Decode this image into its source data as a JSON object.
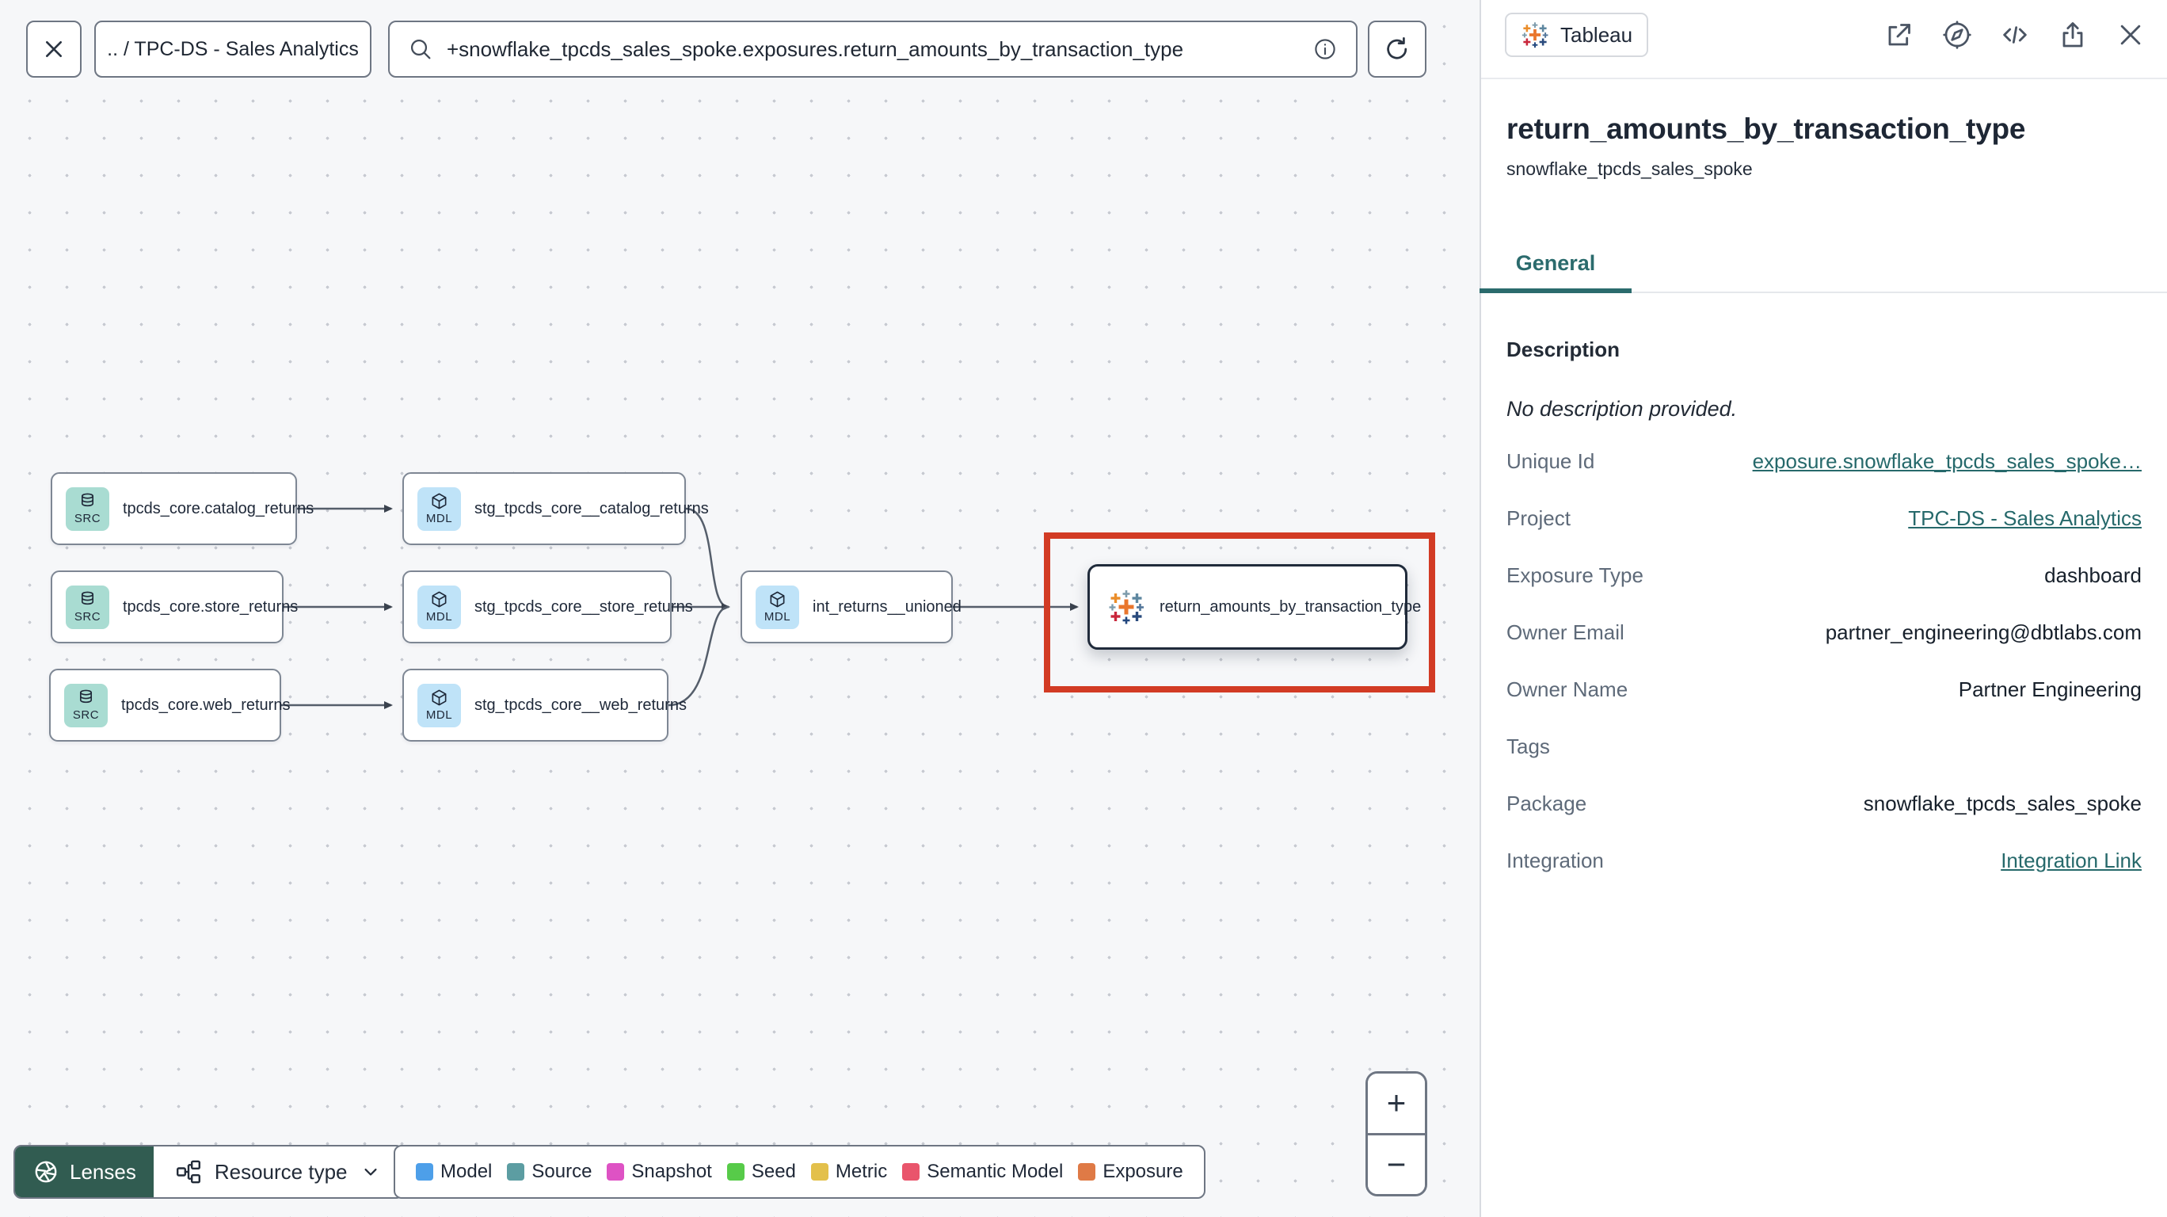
{
  "topbar": {
    "breadcrumb": ".. / TPC-DS - Sales Analytics",
    "search_value": "+snowflake_tpcds_sales_spoke.exposures.return_amounts_by_transaction_type"
  },
  "graph": {
    "badge_src": "SRC",
    "badge_mdl": "MDL",
    "nodes": [
      {
        "label": "tpcds_core.catalog_returns",
        "type": "source"
      },
      {
        "label": "stg_tpcds_core__catalog_returns",
        "type": "model"
      },
      {
        "label": "tpcds_core.store_returns",
        "type": "source"
      },
      {
        "label": "stg_tpcds_core__store_returns",
        "type": "model"
      },
      {
        "label": "tpcds_core.web_returns",
        "type": "source"
      },
      {
        "label": "stg_tpcds_core__web_returns",
        "type": "model"
      },
      {
        "label": "int_returns__unioned",
        "type": "model"
      },
      {
        "label": "return_amounts_by_transaction_type",
        "type": "exposure"
      }
    ]
  },
  "toolbar": {
    "lenses_label": "Lenses",
    "resource_type_label": "Resource type"
  },
  "legend": {
    "items": [
      {
        "label": "Model",
        "color": "#4D9FE9"
      },
      {
        "label": "Source",
        "color": "#5C9DA2"
      },
      {
        "label": "Snapshot",
        "color": "#DE52C4"
      },
      {
        "label": "Seed",
        "color": "#57CB49"
      },
      {
        "label": "Metric",
        "color": "#E3C04B"
      },
      {
        "label": "Semantic Model",
        "color": "#E9556C"
      },
      {
        "label": "Exposure",
        "color": "#DF7A46"
      }
    ]
  },
  "zoom_controls": {
    "zoom_in": "+",
    "zoom_out": "−"
  },
  "panel": {
    "badge_label": "Tableau",
    "title": "return_amounts_by_transaction_type",
    "subtitle": "snowflake_tpcds_sales_spoke",
    "tab_general": "General",
    "description_label": "Description",
    "description_value": "No description provided.",
    "fields": [
      {
        "label": "Unique Id",
        "value": "exposure.snowflake_tpcds_sales_spoke…",
        "link": true
      },
      {
        "label": "Project",
        "value": "TPC-DS - Sales Analytics",
        "link": true
      },
      {
        "label": "Exposure Type",
        "value": "dashboard",
        "link": false
      },
      {
        "label": "Owner Email",
        "value": "partner_engineering@dbtlabs.com",
        "link": false
      },
      {
        "label": "Owner Name",
        "value": "Partner Engineering",
        "link": false
      },
      {
        "label": "Tags",
        "value": "",
        "link": false
      },
      {
        "label": "Package",
        "value": "snowflake_tpcds_sales_spoke",
        "link": false
      },
      {
        "label": "Integration",
        "value": "Integration Link",
        "link": true
      }
    ]
  },
  "colors": {
    "accent_teal": "#2B6B6D",
    "lenses_green": "#315C51",
    "highlight_red": "#D23B24",
    "source_badge_bg": "#A9DCD2",
    "model_badge_bg": "#BFE3F8"
  },
  "icons": {
    "topbar": [
      "close-icon",
      "search-icon",
      "info-icon",
      "refresh-icon"
    ],
    "panel": [
      "external-link-icon",
      "compass-icon",
      "code-icon",
      "share-icon",
      "close-icon"
    ],
    "toolbar": [
      "aperture-icon",
      "hierarchy-icon",
      "chevron-down-icon"
    ],
    "node": [
      "database-icon",
      "cube-icon",
      "tableau-logo-icon"
    ]
  }
}
